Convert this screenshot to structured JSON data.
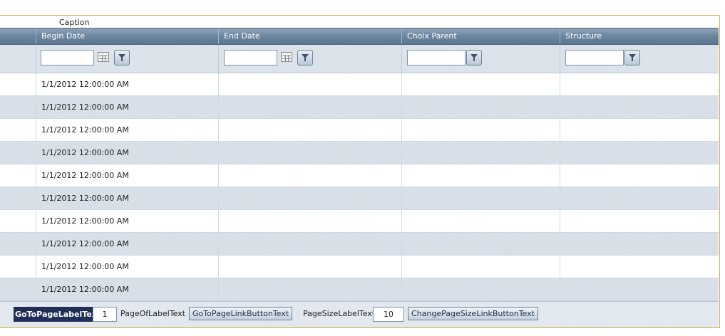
{
  "grid": {
    "caption": "Caption",
    "columns": [
      {
        "label": "Begin Date"
      },
      {
        "label": "End Date"
      },
      {
        "label": "Choix Parent"
      },
      {
        "label": "Structure"
      }
    ],
    "filters": {
      "begin_date": "",
      "end_date": "",
      "choix_parent": "",
      "structure": ""
    },
    "rows": [
      {
        "begin_date": "1/1/2012 12:00:00 AM",
        "end_date": "",
        "choix_parent": "",
        "structure": ""
      },
      {
        "begin_date": "1/1/2012 12:00:00 AM",
        "end_date": "",
        "choix_parent": "",
        "structure": ""
      },
      {
        "begin_date": "1/1/2012 12:00:00 AM",
        "end_date": "",
        "choix_parent": "",
        "structure": ""
      },
      {
        "begin_date": "1/1/2012 12:00:00 AM",
        "end_date": "",
        "choix_parent": "",
        "structure": ""
      },
      {
        "begin_date": "1/1/2012 12:00:00 AM",
        "end_date": "",
        "choix_parent": "",
        "structure": ""
      },
      {
        "begin_date": "1/1/2012 12:00:00 AM",
        "end_date": "",
        "choix_parent": "",
        "structure": ""
      },
      {
        "begin_date": "1/1/2012 12:00:00 AM",
        "end_date": "",
        "choix_parent": "",
        "structure": ""
      },
      {
        "begin_date": "1/1/2012 12:00:00 AM",
        "end_date": "",
        "choix_parent": "",
        "structure": ""
      },
      {
        "begin_date": "1/1/2012 12:00:00 AM",
        "end_date": "",
        "choix_parent": "",
        "structure": ""
      },
      {
        "begin_date": "1/1/2012 12:00:00 AM",
        "end_date": "",
        "choix_parent": "",
        "structure": ""
      }
    ]
  },
  "pager": {
    "goto_page_label": "GoToPageLabelText",
    "page_value": "1",
    "page_of_label": "PageOfLabelText",
    "goto_page_button": "GoToPageLinkButtonText",
    "page_size_label": "PageSizeLabelText",
    "page_size_value": "10",
    "change_page_size_button": "ChangePageSizeLinkButtonText"
  },
  "icons": {
    "calendar": "calendar-icon",
    "filter": "filter-icon"
  },
  "colors": {
    "header": "#6f88a1",
    "alt_row": "#d5dde6",
    "frame_border": "#e0a84a",
    "goto_label_bg": "#1f2f57"
  }
}
